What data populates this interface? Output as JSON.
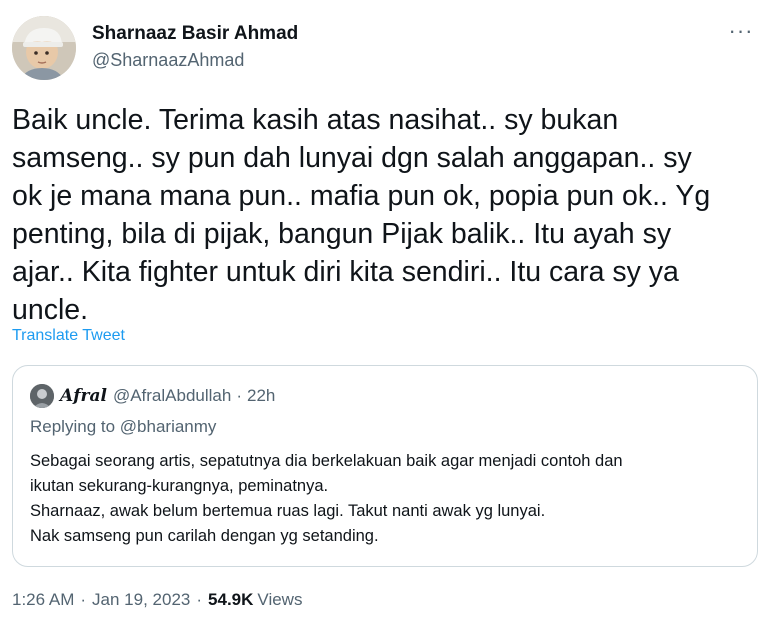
{
  "author": {
    "display_name": "Sharnaaz Basir Ahmad",
    "handle": "@SharnaazAhmad"
  },
  "more_button_glyph": "···",
  "tweet": {
    "text": "Baik uncle. Terima kasih atas nasihat.. sy bukan\nsamseng.. sy pun dah lunyai dgn salah anggapan.. sy\nok je mana mana pun.. mafia pun ok, popia pun ok.. Yg\npenting, bila di pijak, bangun Pijak balik.. Itu ayah sy\najar.. Kita fighter untuk diri kita sendiri.. Itu cara sy ya\nuncle.",
    "translate_label": "Translate Tweet"
  },
  "quoted_tweet": {
    "name": "𝑨𝒇𝒓𝒂𝒍",
    "handle": "@AfralAbdullah",
    "separator": "·",
    "time": "22h",
    "replying_prefix": "Replying to ",
    "replying_to": "@bharianmy",
    "body_lines": [
      "Sebagai seorang artis, sepatutnya dia berkelakuan baik agar menjadi contoh dan",
      "ikutan sekurang-kurangnya, peminatnya.",
      "Sharnaaz, awak belum bertemua ruas lagi. Takut nanti awak yg lunyai.",
      "Nak samseng pun carilah dengan yg setanding."
    ]
  },
  "meta": {
    "time": "1:26 AM",
    "separator": "·",
    "date": "Jan 19, 2023",
    "views_count": "54.9K",
    "views_label": "Views"
  },
  "colors": {
    "link": "#1d9bf0",
    "secondary_text": "#536471",
    "border": "#cfd9de"
  }
}
